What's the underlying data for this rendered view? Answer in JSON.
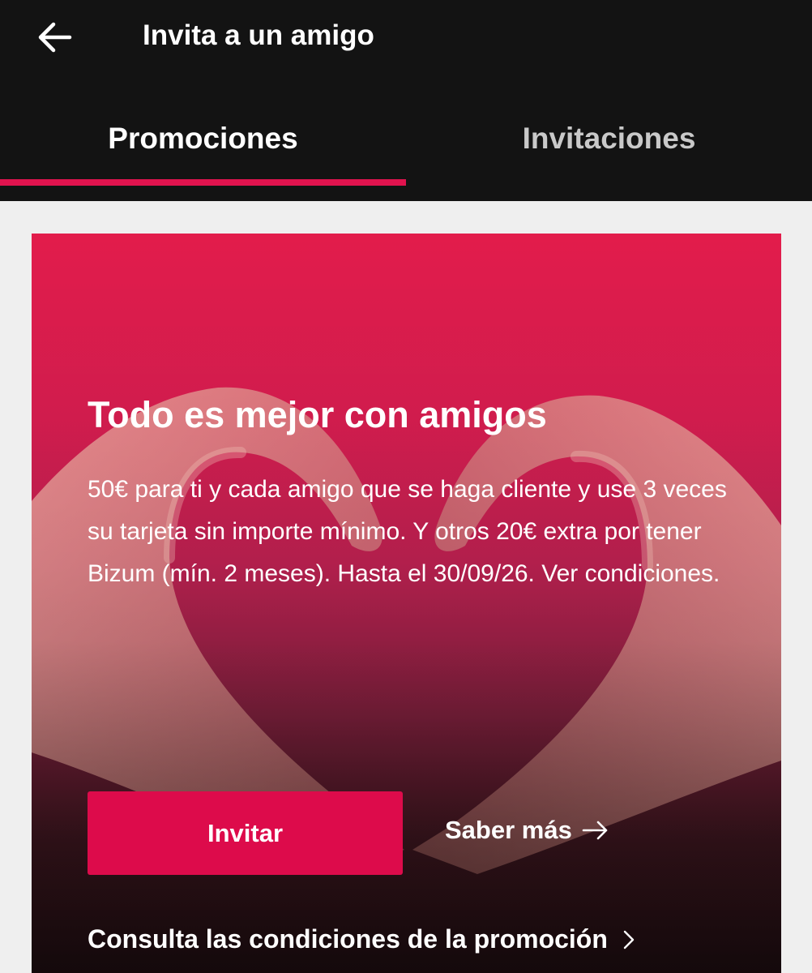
{
  "header": {
    "title": "Invita a un amigo",
    "back_icon": "arrow-left-icon"
  },
  "tabs": [
    {
      "label": "Promociones",
      "active": true
    },
    {
      "label": "Invitaciones",
      "active": false
    }
  ],
  "colors": {
    "accent": "#e0134e",
    "topbar_bg": "#131313",
    "page_bg": "#efefef",
    "button_bg": "#dd0b4b"
  },
  "promo": {
    "title": "Todo es mejor con amigos",
    "description": "50€ para ti y cada amigo que se haga cliente y use 3 veces su tarjeta sin importe mínimo. Y otros 20€ extra por tener Bizum (mín. 2 meses). Hasta el 30/09/26. Ver condiciones.",
    "invite_label": "Invitar",
    "learn_more_label": "Saber más",
    "learn_more_icon": "arrow-right-icon",
    "conditions_label": "Consulta las condiciones de la promoción",
    "conditions_icon": "chevron-right-icon",
    "image": "hands-heart-image"
  }
}
